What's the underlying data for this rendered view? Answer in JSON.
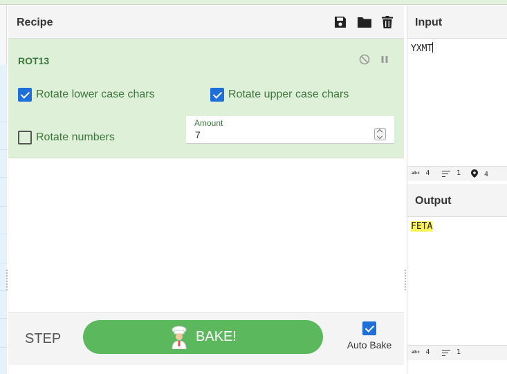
{
  "recipe": {
    "title": "Recipe",
    "icons": [
      "save-icon",
      "folder-icon",
      "trash-icon"
    ]
  },
  "operation": {
    "name": "ROT13",
    "icons": [
      "disable-icon",
      "pause-icon"
    ],
    "rotate_lower": {
      "label": "Rotate lower case chars",
      "checked": true
    },
    "rotate_upper": {
      "label": "Rotate upper case chars",
      "checked": true
    },
    "rotate_numbers": {
      "label": "Rotate numbers",
      "checked": false
    },
    "amount": {
      "label": "Amount",
      "value": "7"
    }
  },
  "bake": {
    "step_label": "STEP",
    "bake_label": "BAKE!",
    "auto_bake_label": "Auto Bake",
    "auto_bake_checked": true
  },
  "input": {
    "title": "Input",
    "text": "YXMT",
    "stats": {
      "length": "4",
      "lines": "1",
      "position": "4",
      "length_icon": "abc"
    }
  },
  "output": {
    "title": "Output",
    "text": "FETA",
    "stats": {
      "length": "4",
      "lines": "1",
      "length_icon": "abc"
    }
  },
  "colors": {
    "operation_bg": "#dff0d8",
    "operation_text": "#3c763d",
    "bake_button": "#5cb85c",
    "checkbox": "#1e6fd9",
    "highlight": "#fff35a"
  }
}
